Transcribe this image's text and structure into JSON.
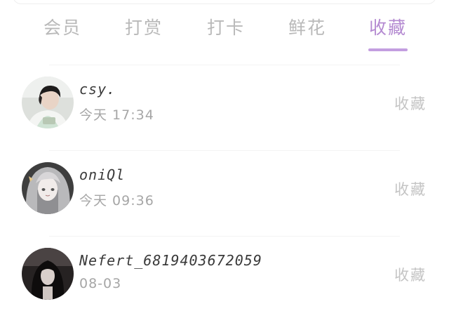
{
  "tabs": [
    {
      "label": "会员",
      "active": false
    },
    {
      "label": "打赏",
      "active": false
    },
    {
      "label": "打卡",
      "active": false
    },
    {
      "label": "鲜花",
      "active": false
    },
    {
      "label": "收藏",
      "active": true
    }
  ],
  "colors": {
    "active_tab": "#b48ad1",
    "indicator": "#c39ee0",
    "inactive_tab": "#b9b9b9",
    "secondary_text": "#a6a6a6"
  },
  "records": [
    {
      "username": "csy.",
      "time": "今天 17:34",
      "action": "收藏",
      "avatar_icon": "avatar-photo-boy"
    },
    {
      "username": "oniQl",
      "time": "今天 09:36",
      "action": "收藏",
      "avatar_icon": "avatar-anime-girl"
    },
    {
      "username": "Nefert_6819403672059",
      "time": "08-03",
      "action": "收藏",
      "avatar_icon": "avatar-dark-girl"
    }
  ]
}
